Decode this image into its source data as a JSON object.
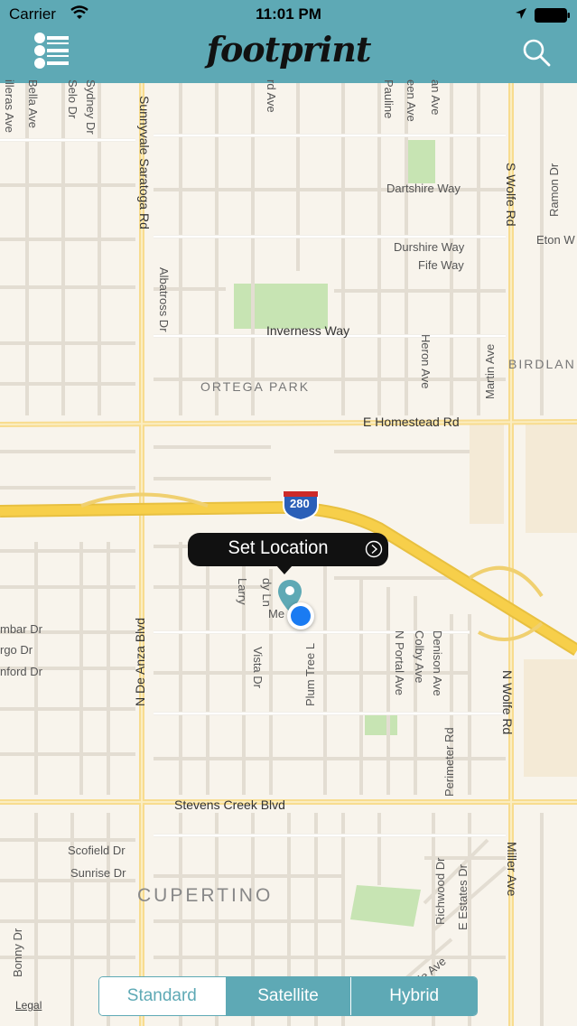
{
  "status_bar": {
    "carrier": "Carrier",
    "time": "11:01 PM"
  },
  "header": {
    "title": "footprint",
    "menu_icon": "menu-list-icon",
    "search_icon": "search-icon",
    "color": "#5ea9b5"
  },
  "map": {
    "labels": {
      "sunnyvale_saratoga": "Sunnyvale Saratoga Rd",
      "albatross": "Albatross Dr",
      "inverness": "Inverness Way",
      "ortega_park": "ORTEGA PARK",
      "e_homestead": "E Homestead Rd",
      "dartshire": "Dartshire Way",
      "durshire": "Durshire Way",
      "fife": "Fife Way",
      "heron": "Heron Ave",
      "martin": "Martin Ave",
      "birdland": "BIRDLAN",
      "s_wolfe": "S Wolfe Rd",
      "ramon": "Ramon Dr",
      "eton": "Eton W",
      "bella": "Bella Ave",
      "sillera": "illeras Ave",
      "selo": "Selo Dr",
      "sydney": "Sydney Dr",
      "paulin": "Pauline",
      "een": "een Ave",
      "an_ave": "an Ave",
      "rd_ave": "rd Ave",
      "hwy_280": "280",
      "n_de_anza": "N De Anza Blvd",
      "larry": "Larry",
      "dy_ln": "dy Ln",
      "me_dr": "Me  Dr",
      "vista": "Vista Dr",
      "plum_tree": "Plum Tree L",
      "n_portal": "N Portal Ave",
      "colby": "Colby Ave",
      "denison": "Denison Ave",
      "perimeter": "Perimeter Rd",
      "n_wolfe": "N Wolfe Rd",
      "mbar": "mbar Dr",
      "rgo": "rgo Dr",
      "nford": "nford Dr",
      "stevens_creek": "Stevens Creek Blvd",
      "scofield": "Scofield Dr",
      "sunrise": "Sunrise Dr",
      "cupertino": "CUPERTINO",
      "bonny": "Bonny Dr",
      "richwood": "Richwood Dr",
      "e_estates": "E Estates Dr",
      "ville": "ville Ave",
      "miller": "Miller Ave"
    },
    "legal": "Legal"
  },
  "callout": {
    "label": "Set Location",
    "button_icon": "disclosure-arrow-icon"
  },
  "segmented_control": {
    "options": [
      "Standard",
      "Satellite",
      "Hybrid"
    ],
    "selected": "Standard"
  }
}
